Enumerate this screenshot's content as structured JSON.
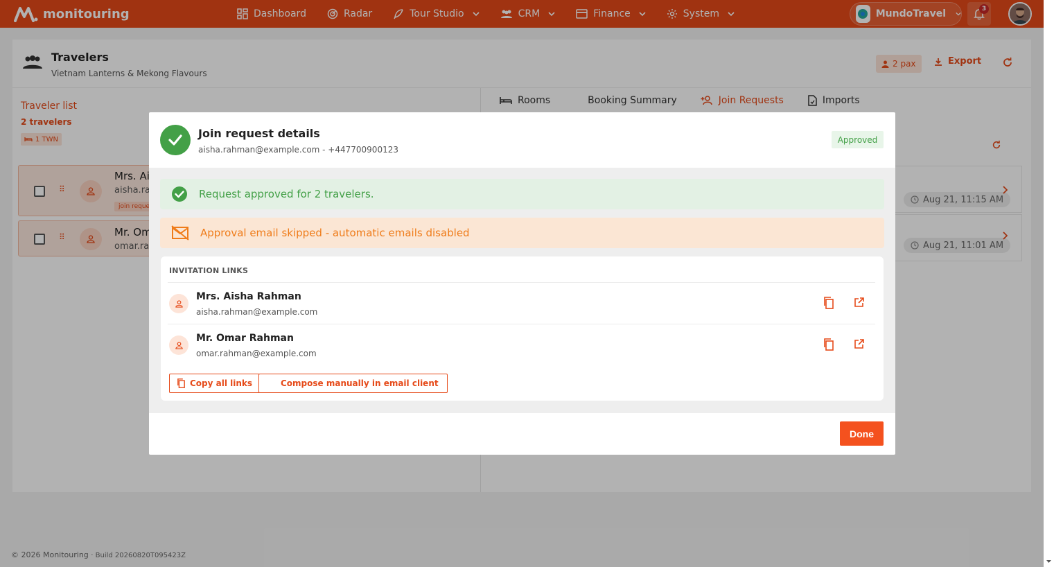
{
  "nav": {
    "brand": "monitouring",
    "items": [
      {
        "label": "Dashboard",
        "icon": "dashboard-icon",
        "has_menu": false
      },
      {
        "label": "Radar",
        "icon": "radar-icon",
        "has_menu": false
      },
      {
        "label": "Tour Studio",
        "icon": "feather-icon",
        "has_menu": true
      },
      {
        "label": "CRM",
        "icon": "people-icon",
        "has_menu": true
      },
      {
        "label": "Finance",
        "icon": "card-icon",
        "has_menu": true
      },
      {
        "label": "System",
        "icon": "gear-icon",
        "has_menu": true
      }
    ],
    "org_name": "MundoTravel",
    "notification_count": "3"
  },
  "header": {
    "title": "Travelers",
    "subtitle": "Vietnam Lanterns & Mekong Flavours",
    "pax_label": "2 pax",
    "export_label": "Export"
  },
  "traveler_list": {
    "title": "Traveler list",
    "count_label": "2 travelers",
    "room_badge": "1 TWN",
    "travelers": [
      {
        "name": "Mrs. Ais",
        "email": "aisha.rah",
        "tag": "join reque"
      },
      {
        "name": "Mr. Om",
        "email": "omar.rah"
      }
    ]
  },
  "tabs": [
    {
      "label": "Rooms",
      "icon": "bed-icon",
      "active": false
    },
    {
      "label": "Booking Summary",
      "icon": "",
      "active": false
    },
    {
      "label": "Join Requests",
      "icon": "person-add-icon",
      "active": true
    },
    {
      "label": "Imports",
      "icon": "file-import-icon",
      "active": false
    }
  ],
  "requests": [
    {
      "date": "Aug 21, 11:15 AM"
    },
    {
      "date": "Aug 21, 11:01 AM"
    }
  ],
  "modal": {
    "title": "Join request details",
    "subtitle": "aisha.rahman@example.com - +447700900123",
    "status": "Approved",
    "alert_success": "Request approved for 2 travelers.",
    "alert_warning": "Approval email skipped - automatic emails disabled",
    "links_title": "INVITATION LINKS",
    "links": [
      {
        "name": "Mrs. Aisha Rahman",
        "email": "aisha.rahman@example.com"
      },
      {
        "name": "Mr. Omar Rahman",
        "email": "omar.rahman@example.com"
      }
    ],
    "copy_all_label": "Copy all links",
    "compose_label": "Compose manually in email client",
    "done_label": "Done"
  },
  "footer": {
    "copyright": "© 2026 Monitouring",
    "build": "· Build 20260820T095423Z"
  },
  "colors": {
    "brand": "#e64a19",
    "success": "#43a047",
    "warning": "#ef7c1a"
  }
}
